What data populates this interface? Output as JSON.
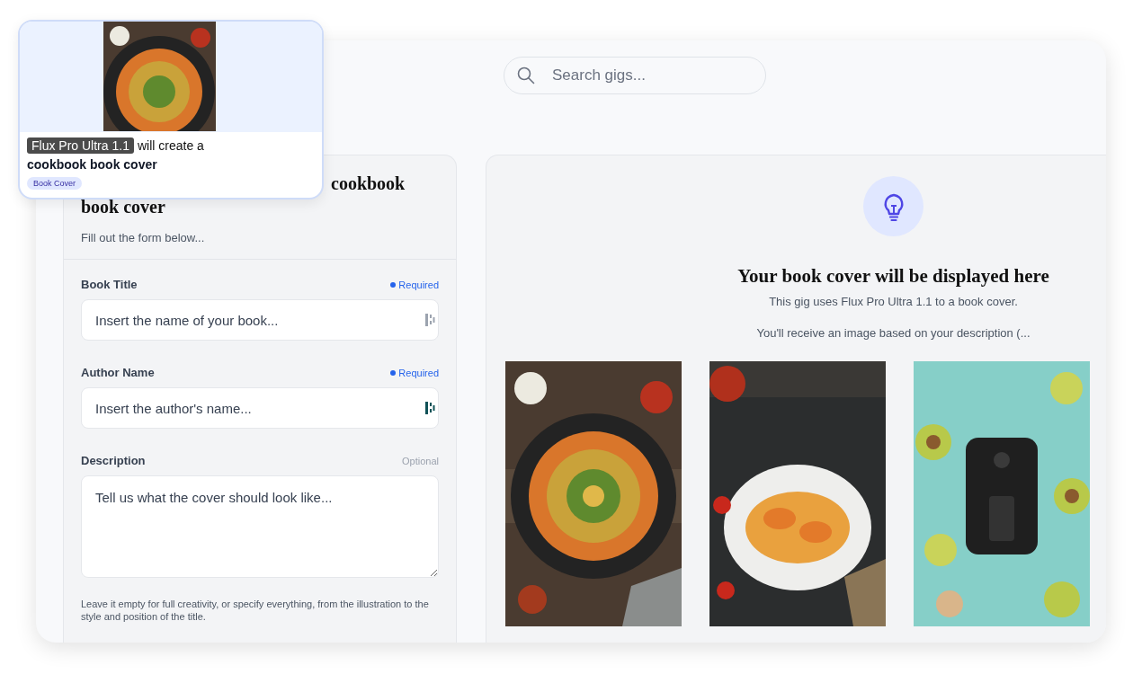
{
  "search": {
    "placeholder": "Search gigs..."
  },
  "preview_card": {
    "model": "Flux Pro Ultra 1.1",
    "text": "will create a",
    "product": "cookbook book cover",
    "tag": "Book Cover"
  },
  "form": {
    "title": "cookbook book cover",
    "subtitle": "Fill out the form below...",
    "fields": [
      {
        "kind": "input",
        "label": "Book Title",
        "requirement": "Required",
        "required": true,
        "placeholder": "Insert the name of your book..."
      },
      {
        "kind": "input",
        "label": "Author Name",
        "requirement": "Required",
        "required": true,
        "placeholder": "Insert the author's name..."
      },
      {
        "kind": "textarea",
        "label": "Description",
        "requirement": "Optional",
        "required": false,
        "placeholder": "Tell us what the cover should look like..."
      }
    ],
    "hint": "Leave it empty for full creativity, or specify everything, from the illustration to the style and position of the title."
  },
  "result": {
    "title": "Your book cover will be displayed here",
    "lines": [
      "This gig uses Flux Pro Ultra 1.1 to a book cover.",
      "You'll receive an image based on your description (..."
    ],
    "examples": [
      {
        "kind": "picture"
      },
      {
        "kind": "picture"
      },
      {
        "kind": "picture"
      }
    ]
  }
}
